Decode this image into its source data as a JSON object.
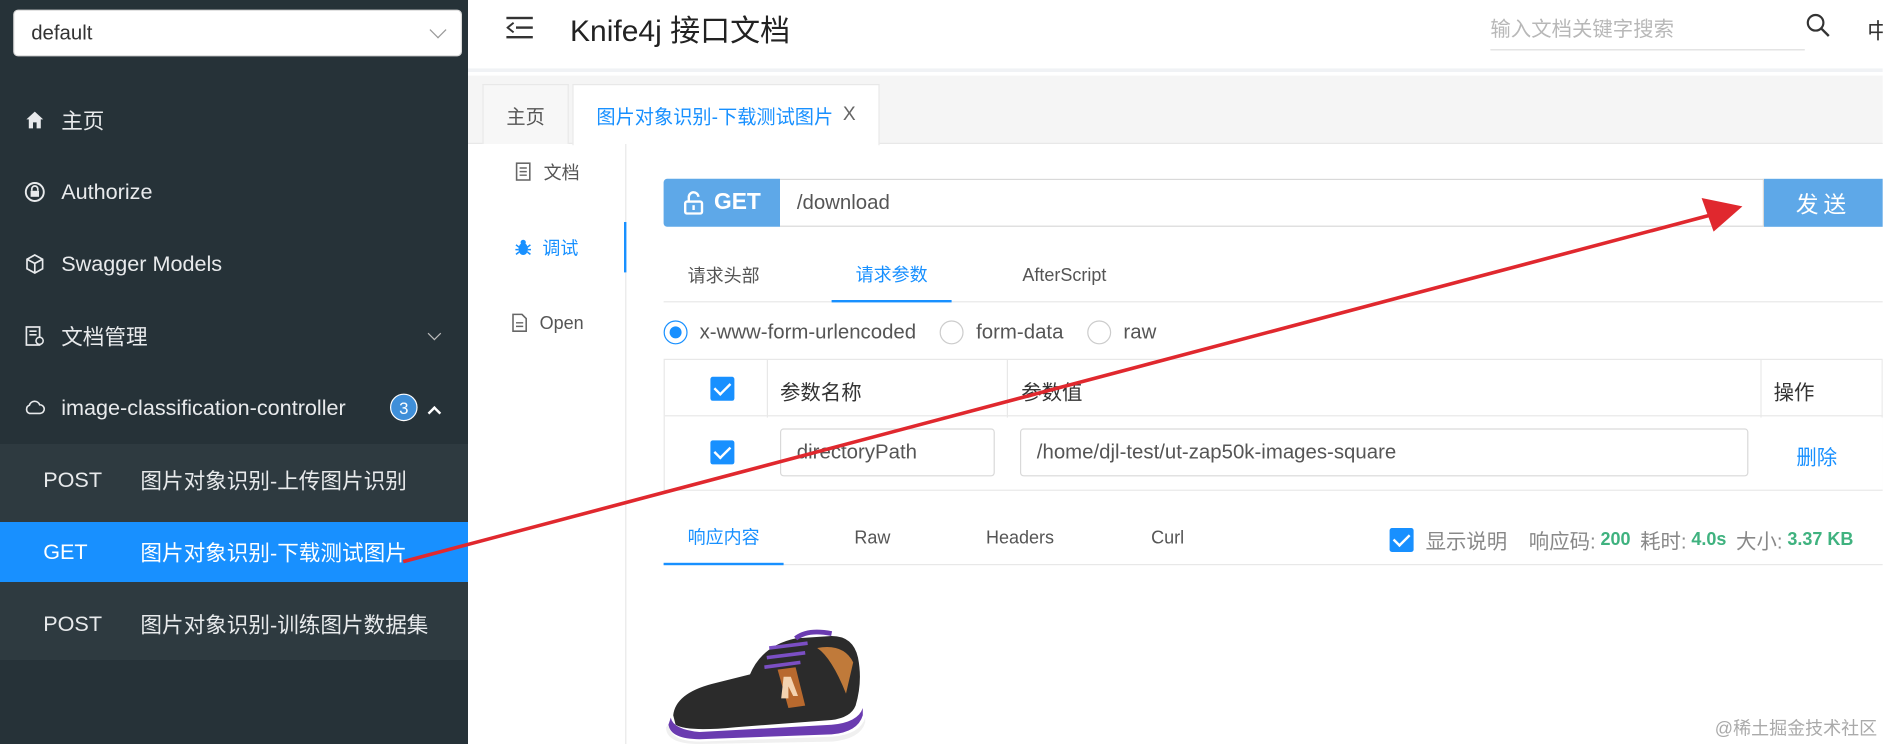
{
  "sidebar": {
    "group_select": "default",
    "nav": [
      {
        "label": "主页",
        "icon": "home-icon"
      },
      {
        "label": "Authorize",
        "icon": "lock-icon"
      },
      {
        "label": "Swagger Models",
        "icon": "cube-icon"
      },
      {
        "label": "文档管理",
        "icon": "document-manage-icon"
      },
      {
        "label": "image-classification-controller",
        "icon": "cloud-icon",
        "badge": "3"
      }
    ],
    "endpoints": [
      {
        "method": "POST",
        "summary": "图片对象识别-上传图片识别"
      },
      {
        "method": "GET",
        "summary": "图片对象识别-下载测试图片"
      },
      {
        "method": "POST",
        "summary": "图片对象识别-训练图片数据集"
      }
    ]
  },
  "header": {
    "title": "Knife4j 接口文档",
    "search_placeholder": "输入文档关键字搜索",
    "lang": "中"
  },
  "page_tabs": [
    {
      "label": "主页"
    },
    {
      "label": "图片对象识别-下载测试图片",
      "close": "X"
    }
  ],
  "side_tabs": [
    {
      "label": "文档"
    },
    {
      "label": "调试"
    },
    {
      "label": "Open"
    }
  ],
  "request": {
    "method": "GET",
    "path": "/download",
    "send_label": "发送",
    "tabs": [
      "请求头部",
      "请求参数",
      "AfterScript"
    ],
    "content_types": [
      "x-www-form-urlencoded",
      "form-data",
      "raw"
    ],
    "params_header": {
      "name": "参数名称",
      "value": "参数值",
      "action": "操作"
    },
    "params": [
      {
        "name": "directoryPath",
        "value": "/home/djl-test/ut-zap50k-images-square",
        "action": "删除"
      }
    ]
  },
  "response": {
    "tabs": [
      "响应内容",
      "Raw",
      "Headers",
      "Curl"
    ],
    "show_desc": "显示说明",
    "code_label": "响应码:",
    "code": "200",
    "time_label": "耗时:",
    "time": "4.0s",
    "size_label": "大小:",
    "size": "3.37 KB"
  },
  "watermark": "@稀土掘金技术社区",
  "colors": {
    "sidebar_bg": "#263238",
    "accent": "#1890ff",
    "method_bg": "#5ea8e8",
    "annotation_arrow": "#e0282e"
  }
}
